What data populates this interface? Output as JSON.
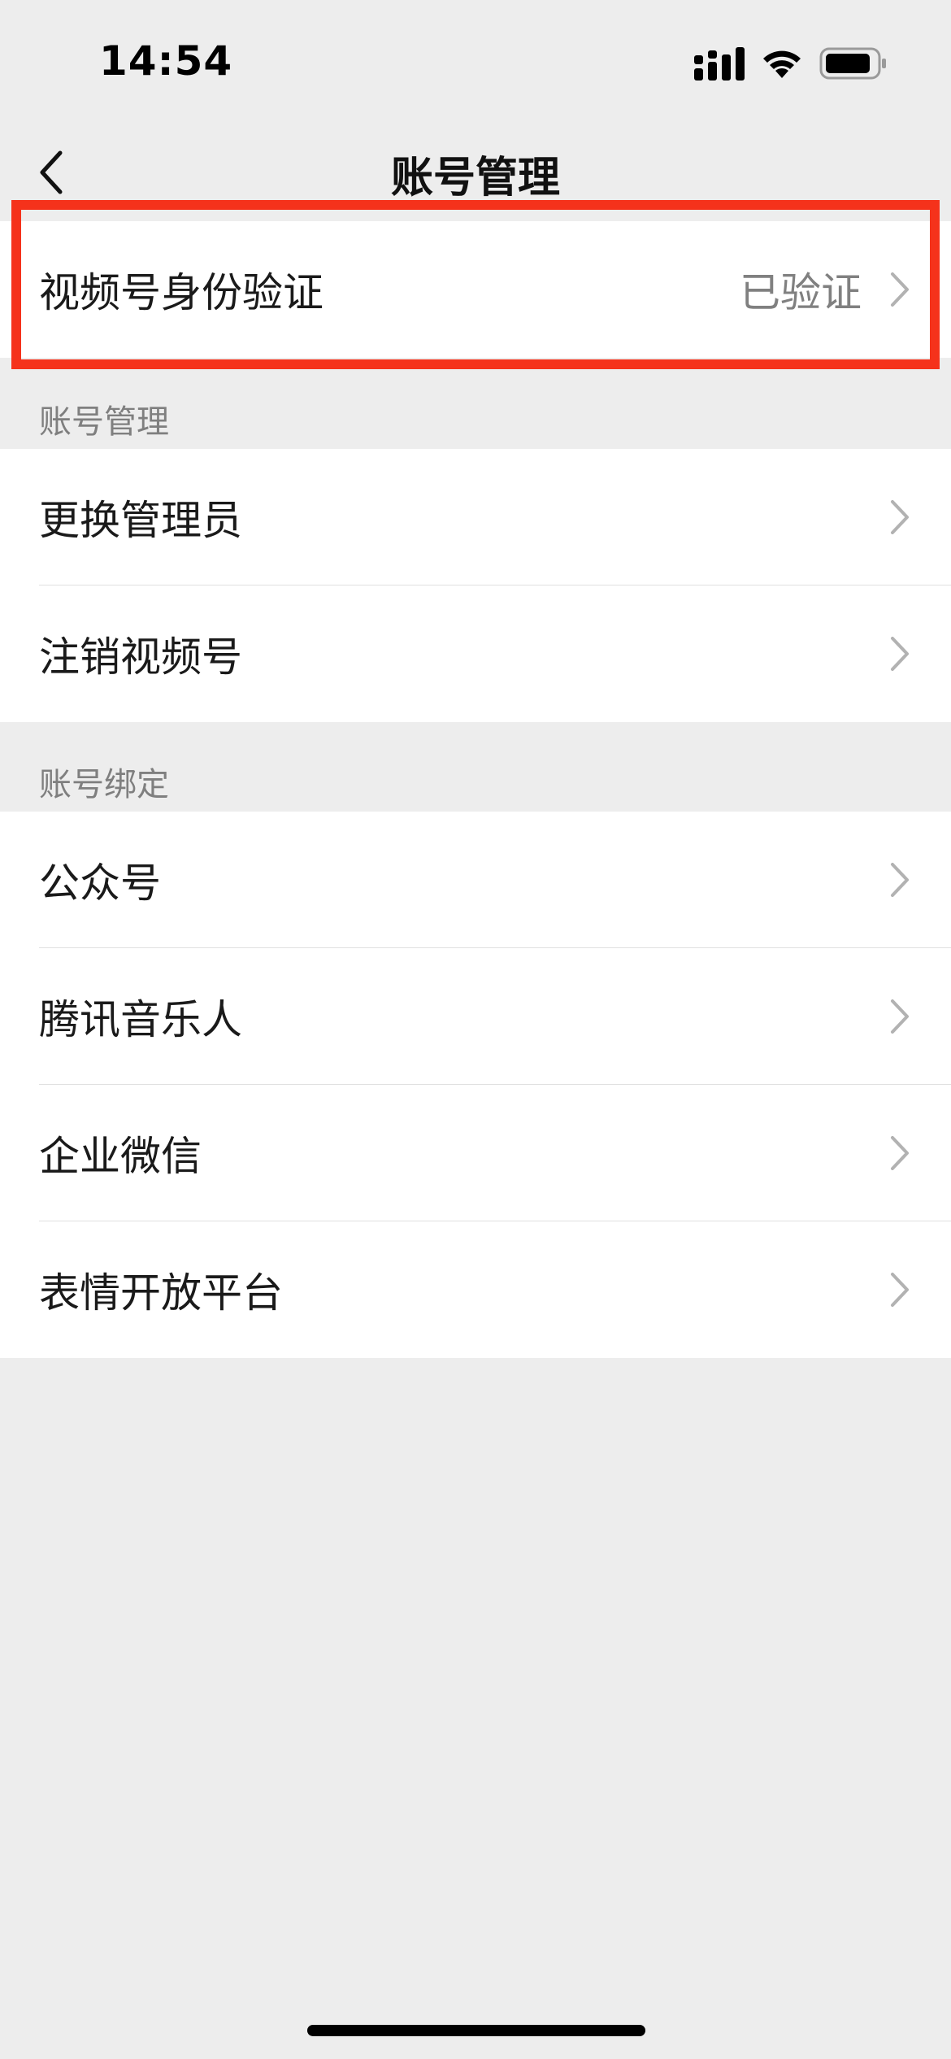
{
  "status_bar": {
    "time": "14:54",
    "icons": [
      "signal-icon",
      "wifi-icon",
      "battery-icon"
    ]
  },
  "nav": {
    "title": "账号管理",
    "back_icon": "chevron-left-icon"
  },
  "verification": {
    "label": "视频号身份验证",
    "value": "已验证",
    "highlight_color": "#f5321b"
  },
  "account_management": {
    "header": "账号管理",
    "items": [
      {
        "label": "更换管理员"
      },
      {
        "label": "注销视频号"
      }
    ]
  },
  "account_binding": {
    "header": "账号绑定",
    "items": [
      {
        "label": "公众号"
      },
      {
        "label": "腾讯音乐人"
      },
      {
        "label": "企业微信"
      },
      {
        "label": "表情开放平台"
      }
    ]
  },
  "colors": {
    "background": "#ededed",
    "cell": "#ffffff",
    "secondary_text": "#808080"
  }
}
